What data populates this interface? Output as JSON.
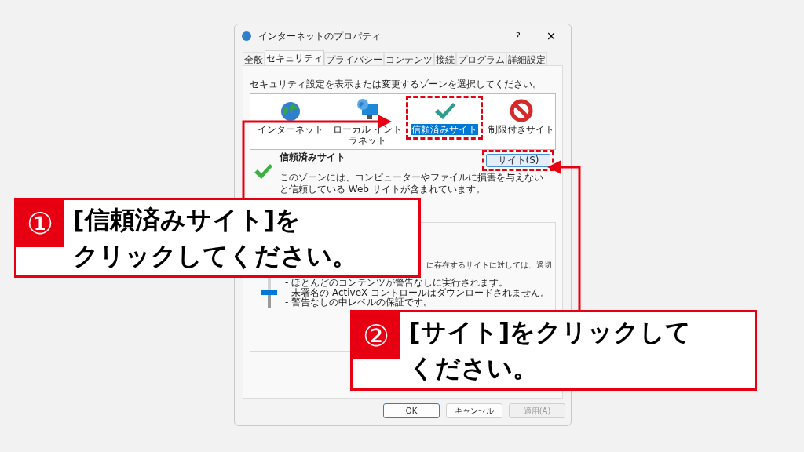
{
  "dialog": {
    "title": "インターネットのプロパティ",
    "help": "?",
    "close": "×",
    "tabs": [
      {
        "label": "全般",
        "selected": false
      },
      {
        "label": "セキュリティ",
        "selected": true
      },
      {
        "label": "プライバシー",
        "selected": false
      },
      {
        "label": "コンテンツ",
        "selected": false
      },
      {
        "label": "接続",
        "selected": false
      },
      {
        "label": "プログラム",
        "selected": false
      },
      {
        "label": "詳細設定",
        "selected": false
      }
    ],
    "prompt": "セキュリティ設定を表示または変更するゾーンを選択してください。",
    "zones": [
      {
        "label": "インターネット",
        "kind": "globe",
        "selected": false
      },
      {
        "label": "ローカル イントラネット",
        "kind": "intranet",
        "selected": false
      },
      {
        "label": "信頼済みサイト",
        "kind": "trusted",
        "selected": true
      },
      {
        "label": "制限付きサイト",
        "kind": "restricted",
        "selected": false
      }
    ],
    "zone_info": {
      "title": "信頼済みサイト",
      "description": [
        "このゾーンには、コンピューターやファイルに損害を与えない",
        "と信頼している Web サイトが含まれています。"
      ],
      "button": "サイト(S)"
    },
    "partial_line": "に存在するサイトに対しては、適切",
    "level_slider": {
      "level": 0.5
    },
    "level_notes": [
      "- ほとんどのコンテンツが警告なしに実行されます。",
      "- 未署名の ActiveX コントロールはダウンロードされません。",
      "- 警告なしの中レベルの保証です。"
    ],
    "buttons": [
      {
        "label": "OK",
        "default": true,
        "disabled": false
      },
      {
        "label": "キャンセル",
        "default": false,
        "disabled": false
      },
      {
        "label": "適用(A)",
        "default": false,
        "disabled": true
      }
    ]
  },
  "callouts": [
    {
      "number": "①",
      "lines": [
        "[信頼済みサイト]を",
        "クリックしてください。"
      ]
    },
    {
      "number": "②",
      "lines": [
        "[サイト]をクリックして",
        "ください。"
      ]
    }
  ]
}
